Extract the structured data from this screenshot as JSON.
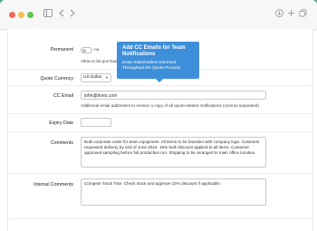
{
  "window": {
    "toolbar_icons": [
      "download-icon",
      "plus-icon",
      "copy-icon"
    ]
  },
  "form": {
    "permanent": {
      "label": "Permanent",
      "toggle_value": "no",
      "hint": "Allow to be purchased"
    },
    "quote_currency": {
      "label": "Quote Currency",
      "value": "US Dollar"
    },
    "cc_email": {
      "label": "CC Email",
      "value": "john@does.com",
      "hint": "Additional email addresses to receive a copy of all quote-related notifications (comma separated)."
    },
    "expiry_date": {
      "label": "Expiry Date",
      "value": ""
    },
    "comments": {
      "label": "Comments",
      "value": "Bulk corporate order for team equipment. All items to be branded with company logo. Customer requested delivery by end of June 2024. 15% bulk discount applied to all items. Customer approved sampling before full production run. Shipping to be arranged to main office location."
    },
    "internal_comments": {
      "label": "Internal Comments",
      "value": "Compete Track Tote: Check stock and approve 15% discount if applicable."
    }
  },
  "tooltip": {
    "title": "Add CC Emails for Team Notifications",
    "body": "Keep Stakeholders Informed Throughout the Quote Process"
  }
}
